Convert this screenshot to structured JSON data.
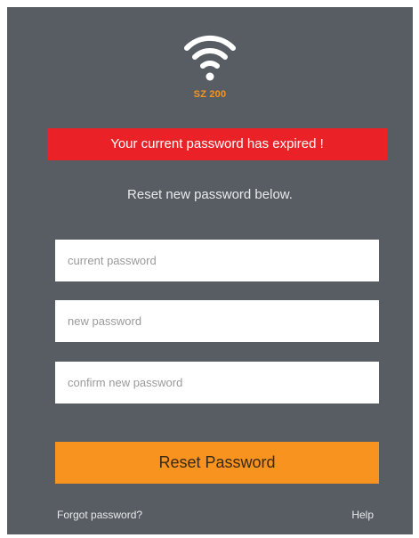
{
  "logo": {
    "icon": "wifi-icon",
    "model": "SZ 200",
    "accent_color": "#f7941d"
  },
  "alert": {
    "message": "Your current password has expired !",
    "color": "#ea2228"
  },
  "instruction": "Reset new password below.",
  "form": {
    "current_password_placeholder": "current password",
    "new_password_placeholder": "new password",
    "confirm_password_placeholder": "confirm new password",
    "submit_label": "Reset Password",
    "submit_color": "#f7931e"
  },
  "footer": {
    "forgot_label": "Forgot password?",
    "help_label": "Help"
  },
  "colors": {
    "panel_background": "#585d63"
  }
}
